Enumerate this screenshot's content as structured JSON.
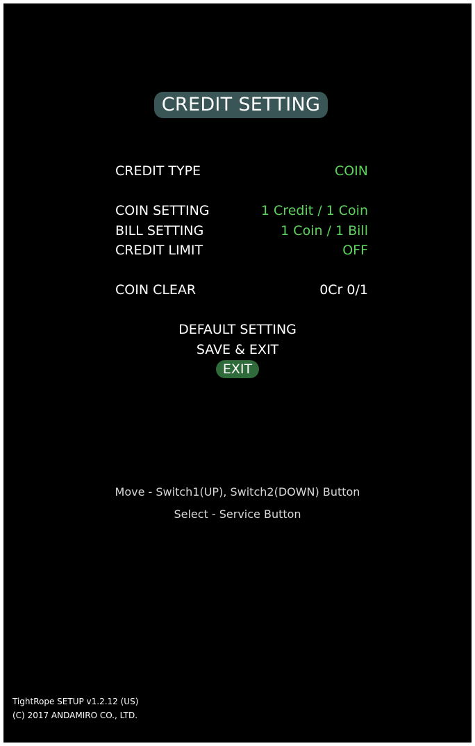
{
  "header": {
    "title": "CREDIT SETTING"
  },
  "settings": [
    {
      "label": "CREDIT TYPE",
      "value": "COIN"
    },
    {
      "label": "COIN SETTING",
      "value": "1 Credit / 1 Coin"
    },
    {
      "label": "BILL SETTING",
      "value": "1 Coin / 1 Bill"
    },
    {
      "label": "CREDIT LIMIT",
      "value": "OFF"
    },
    {
      "label": "COIN CLEAR",
      "value": "0Cr 0/1"
    }
  ],
  "menu": {
    "default_setting": "DEFAULT SETTING",
    "save_exit": "SAVE & EXIT",
    "exit": "EXIT"
  },
  "help": {
    "move": "Move - Switch1(UP), Switch2(DOWN) Button",
    "select": "Select - Service Button"
  },
  "footer": {
    "version": "TightRope SETUP v1.2.12 (US)",
    "copyright": "(C) 2017 ANDAMIRO CO., LTD."
  },
  "colors": {
    "background": "#000000",
    "title_pill": "#3a5555",
    "value_green": "#5cd35c",
    "selected_pill": "#2f6b3a",
    "text": "#ffffff"
  }
}
